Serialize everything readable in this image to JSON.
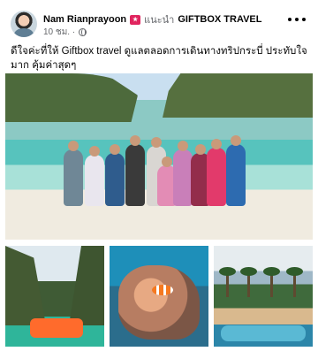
{
  "post": {
    "author": "Nam Rianprayoon",
    "recommend_text": "แนะนำ",
    "page_name": "GIFTBOX TRAVEL",
    "time": "10 ชม. ·",
    "text": "ดีใจค่ะที่ให้ Giftbox travel ดูแลตลอดการเดินทางทริปกระบี่ ประทับใจมาก คุ้มค่าสุดๆ"
  },
  "icons": {
    "avatar": "profile-avatar",
    "badge": "recommend-flag-icon",
    "privacy": "globe-icon",
    "more": "more-options-icon"
  },
  "colors": {
    "text_primary": "#050505",
    "text_secondary": "#65676b",
    "badge": "#e0245e"
  },
  "photos": [
    {
      "name": "group-photo-beach"
    },
    {
      "name": "photo-boat-cliffs"
    },
    {
      "name": "photo-clownfish-coral"
    },
    {
      "name": "photo-resort-pool"
    }
  ]
}
